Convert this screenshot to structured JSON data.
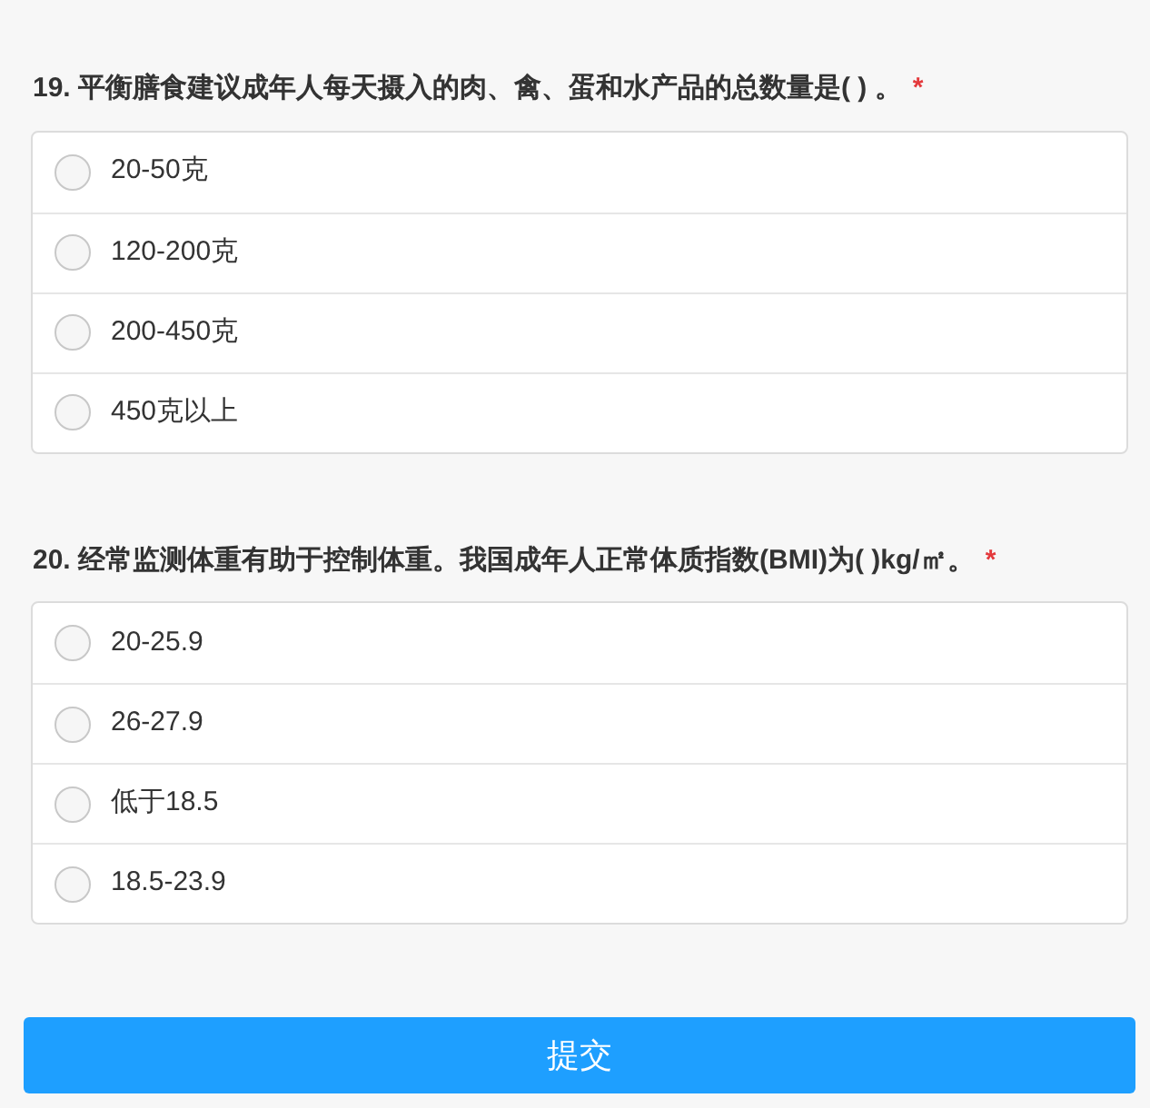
{
  "questions": [
    {
      "title": "19. 平衡膳食建议成年人每天摄入的肉、禽、蛋和水产品的总数量是(   ) 。",
      "required_mark": "*",
      "options": [
        {
          "label": "20-50克",
          "selected": false
        },
        {
          "label": "120-200克",
          "selected": false
        },
        {
          "label": "200-450克",
          "selected": false
        },
        {
          "label": "450克以上",
          "selected": false
        }
      ]
    },
    {
      "title": "20. 经常监测体重有助于控制体重。我国成年人正常体质指数(BMI)为(    )kg/㎡。",
      "required_mark": "*",
      "options": [
        {
          "label": "20-25.9",
          "selected": false
        },
        {
          "label": "26-27.9",
          "selected": false
        },
        {
          "label": "低于18.5",
          "selected": false
        },
        {
          "label": "18.5-23.9",
          "selected": false
        }
      ]
    }
  ],
  "submit_button": "提交"
}
